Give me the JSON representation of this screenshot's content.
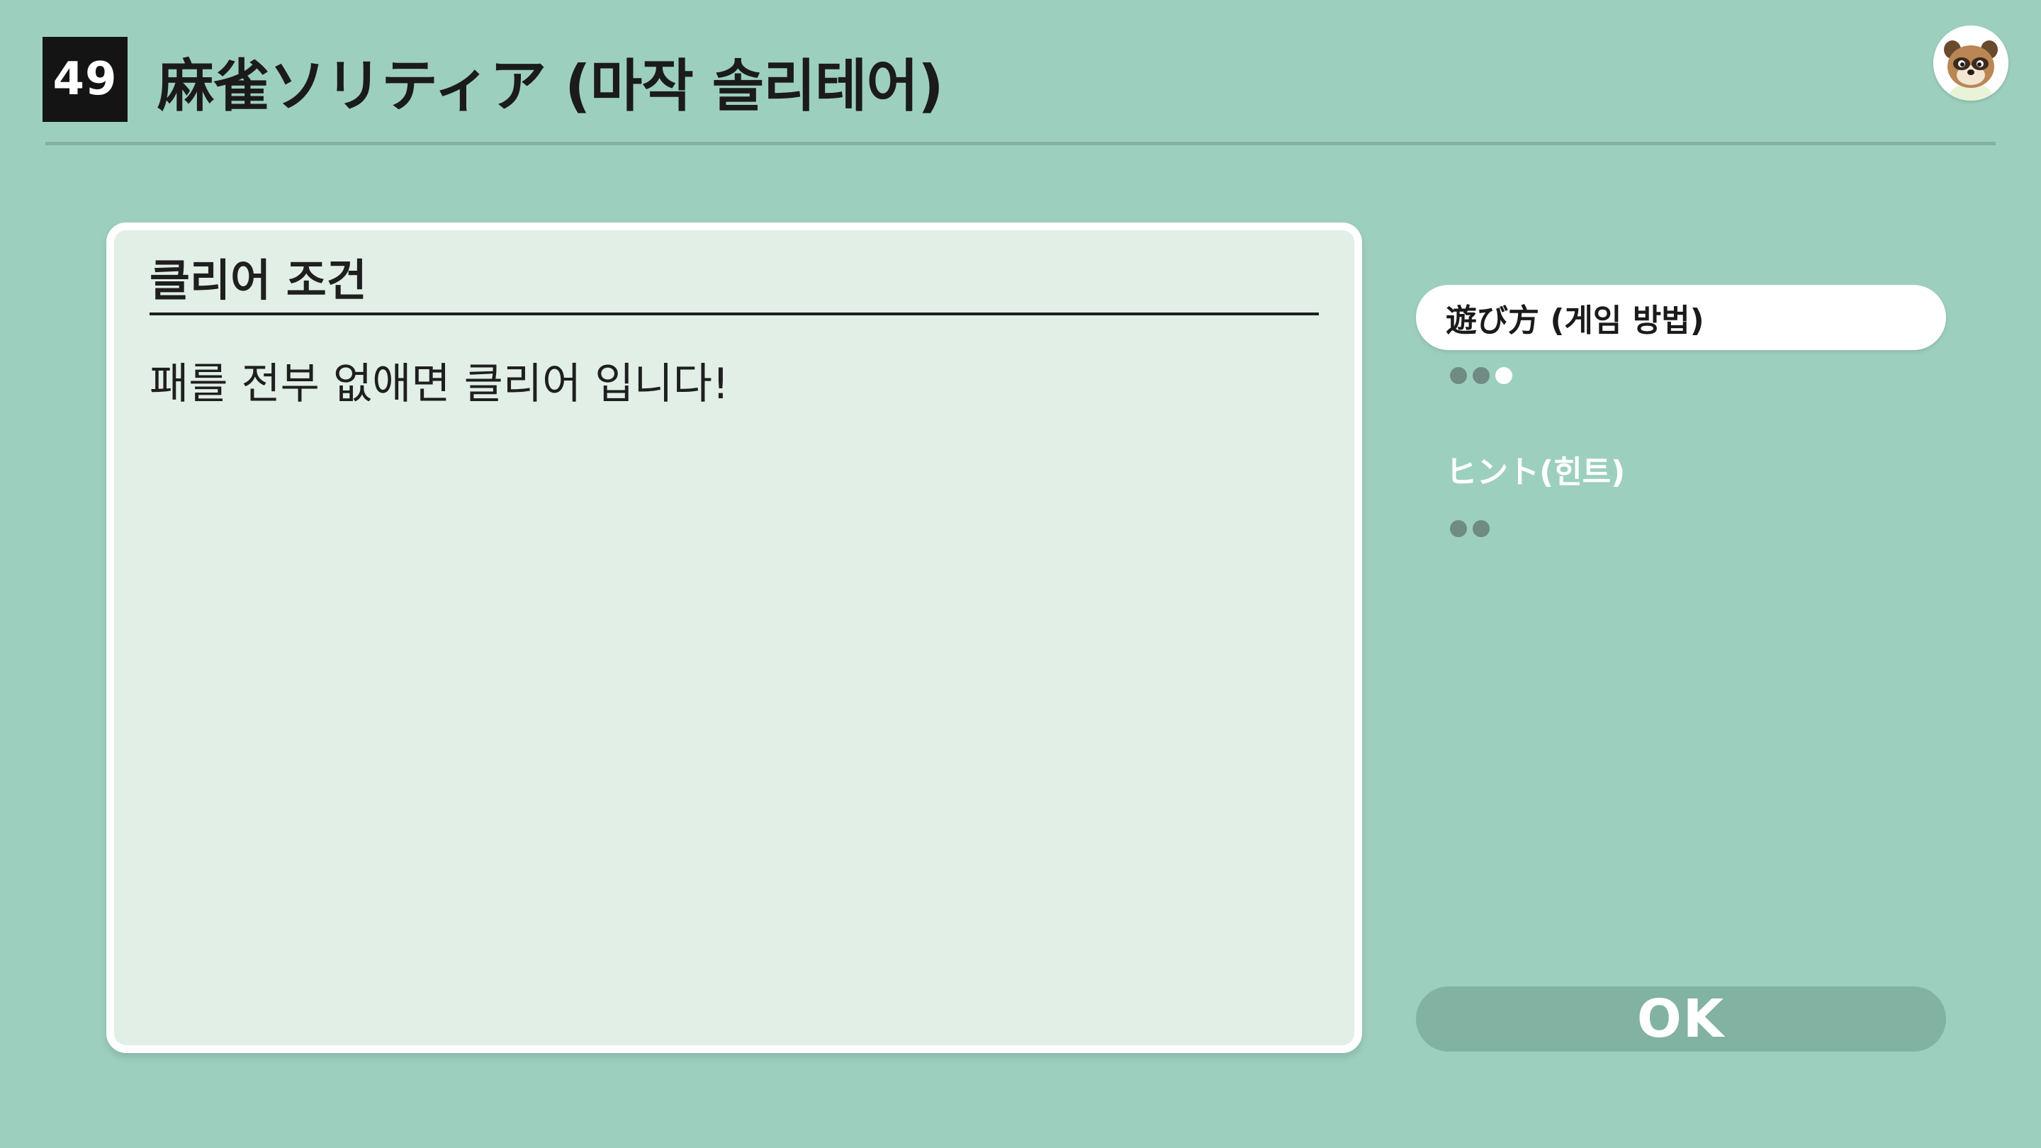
{
  "header": {
    "number": "49",
    "title": "麻雀ソリティア (마작 솔리테어)"
  },
  "panel": {
    "heading": "클리어 조건",
    "body": "패를 전부 없애면 클리어 입니다!"
  },
  "menu": [
    {
      "label": "遊び方 (게임 방법)",
      "active": true,
      "dots": 3,
      "current_dot": 3
    },
    {
      "label": "ヒント(힌트)",
      "active": false,
      "dots": 2,
      "current_dot": 0
    }
  ],
  "ok_button": {
    "label": "OK"
  },
  "avatar": {
    "icon": "raccoon-character-icon"
  },
  "colors": {
    "background": "#9dcfbf",
    "panel": "#e1efe6",
    "ok_button": "#82b2a2",
    "dot_inactive": "#6f8b83",
    "dot_active": "#ffffff"
  }
}
